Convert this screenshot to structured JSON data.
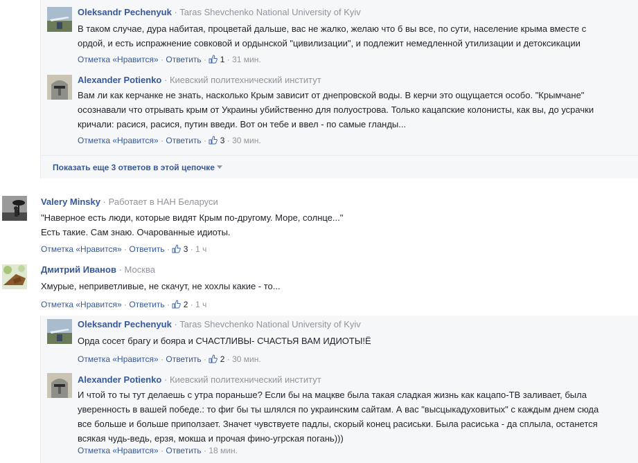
{
  "actions": {
    "like_label": "Отметка «Нравится»",
    "dot": "·",
    "reply_label": "Ответить"
  },
  "more_replies": "Показать еще 3 ответов в этой цепочке",
  "comments": [
    {
      "name": "Oleksandr Pechenyuk",
      "work": "Taras Shevchenko National University of Kyiv",
      "lines": [
        "В таком случае, дура набитая, процветай дальше, вас не жалко, желаю что б вы все, по сути, население крыма вместе с",
        "ордой, и есть испражнение совковой и ордынской \"цивилизации\", и подлежит немедленной утилизации и детоксикации"
      ],
      "likes": "1",
      "time": "31 мин."
    },
    {
      "name": "Alexander Potienko",
      "work": "Киевский политехнический институт",
      "lines": [
        "Вам ли как керчанке не знать, насколько Крым зависит от днепровской воды. В керчи это ощущается особо. \"Крымчане\"",
        "осознавали что отрывать крым от Украины убийственно для полуострова. Только кацапские колонисты, как вы, до усрачки",
        "кричали: расися, расися, путин введи. Вот он тебе и ввел - по самые гланды..."
      ],
      "likes": "3",
      "time": "30 мин."
    },
    {
      "name": "Valery Minsky",
      "work": "Работает в НАН Беларуси",
      "lines": [
        "\"Наверное есть люди, которые видят Крым по-другому. Море, солнце...\"",
        "Есть такие. Сам знаю. Очарованные идиоты."
      ],
      "likes": "3",
      "time": "1 ч"
    },
    {
      "name": "Дмитрий Иванов",
      "work": "Москва",
      "lines": [
        "Хмурые, неприветливые, не скачут, не хохлы какие - то..."
      ],
      "likes": "2",
      "time": "1 ч"
    },
    {
      "name": "Oleksandr Pechenyuk",
      "work": "Taras Shevchenko National University of Kyiv",
      "lines": [
        "Орда сосет брагу и бояра и СЧАСТЛИВЫ- СЧАСТЬЯ ВАМ ИДИОТЫ!Ё"
      ],
      "likes": "2",
      "time": "30 мин."
    },
    {
      "name": "Alexander Potienko",
      "work": "Киевский политехнический институт",
      "lines": [
        "И чтой то ты тут делаешь с утра пораньше? Если бы на мацкве была такая сладкая жизнь как кацапо-ТВ заливает, была",
        "уверенность в вашей победе.: то фиг бы ты шлялся по украинским сайтам. А вас \"высцыкадуховитых\" с каждым днем сюда",
        "все больше и больше приползает. Значет чувствуете падлы, скорый конец расиськи. Была расиська - да сплыла, останется",
        "всякая чудь-ведь, ерзя, мокша и прочая фино-угрская погань)))"
      ],
      "likes": "",
      "time": "18 мин."
    }
  ]
}
